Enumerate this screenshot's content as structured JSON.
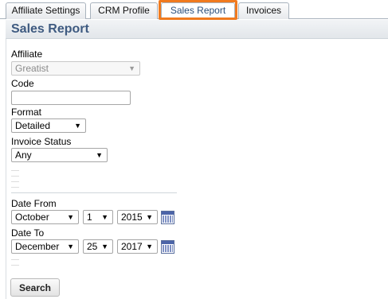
{
  "tabs": [
    {
      "label": "Affiliate Settings"
    },
    {
      "label": "CRM Profile"
    },
    {
      "label": "Sales Report"
    },
    {
      "label": "Invoices"
    }
  ],
  "page": {
    "title": "Sales Report"
  },
  "form": {
    "affiliate": {
      "label": "Affiliate",
      "value": "Greatist"
    },
    "code": {
      "label": "Code",
      "value": ""
    },
    "format": {
      "label": "Format",
      "value": "Detailed"
    },
    "invoice_status": {
      "label": "Invoice Status",
      "value": "Any"
    },
    "date_from": {
      "label": "Date From",
      "month": "October",
      "day": "1",
      "year": "2015"
    },
    "date_to": {
      "label": "Date To",
      "month": "December",
      "day": "25",
      "year": "2017"
    },
    "search_label": "Search"
  },
  "icons": {
    "calendar": "calendar-icon",
    "dropdown": "chevron-down-icon"
  },
  "colors": {
    "tab_highlight": "#f07a1f",
    "title": "#3e5a80"
  }
}
